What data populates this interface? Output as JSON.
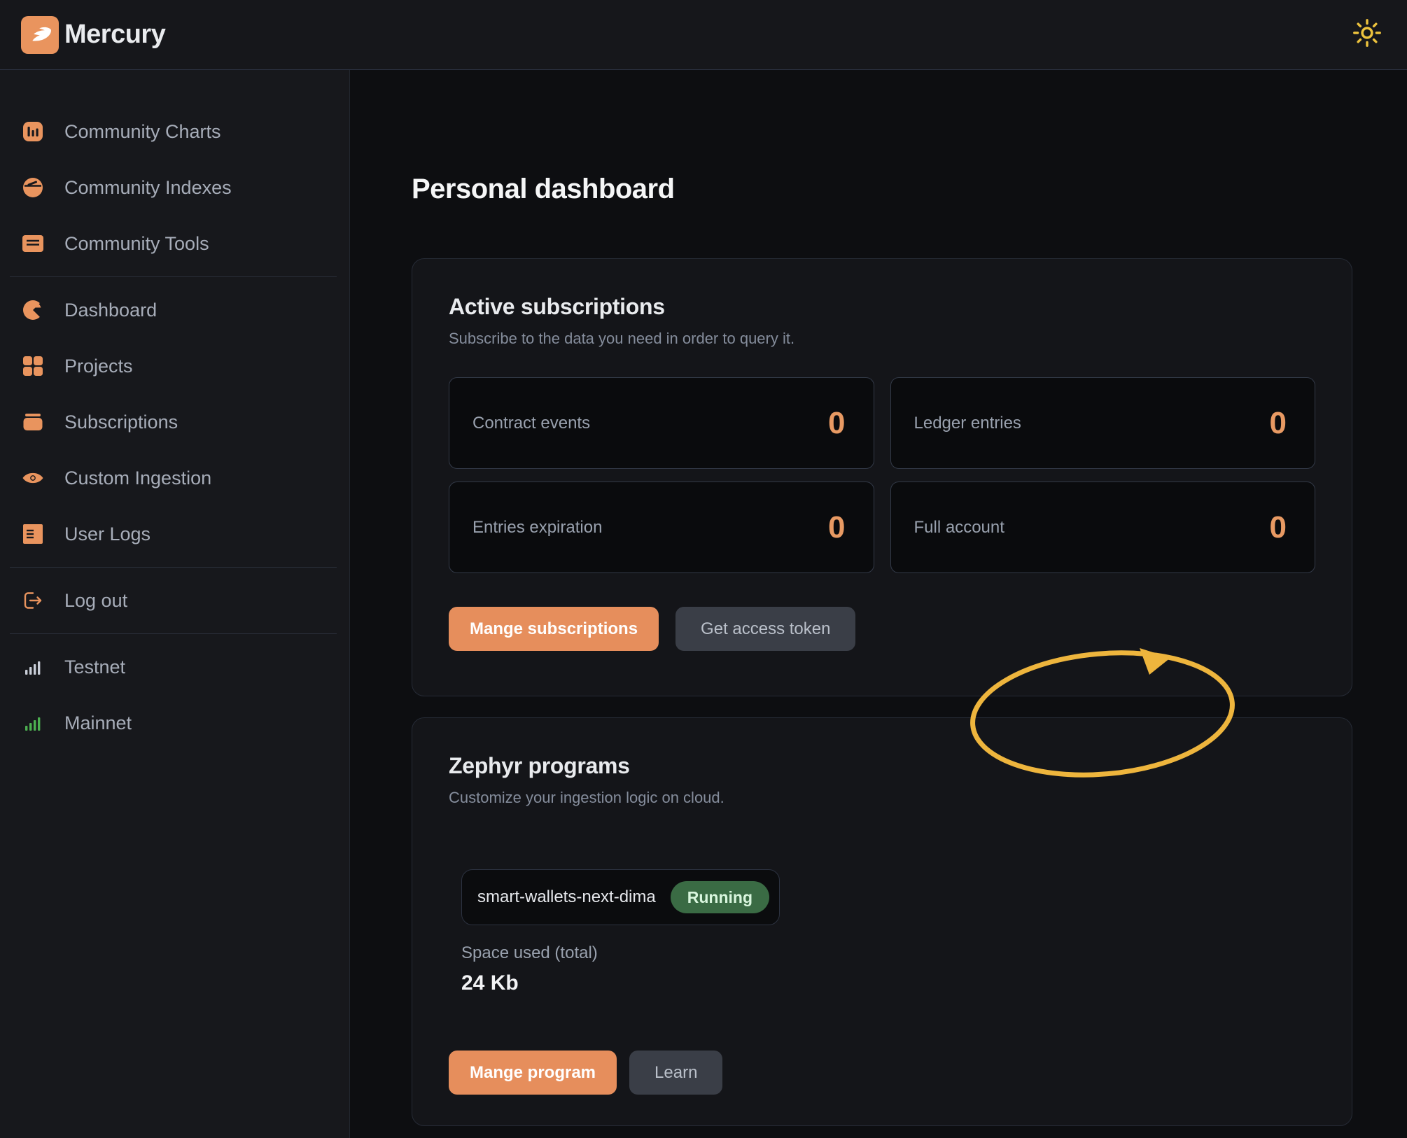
{
  "header": {
    "app_name": "Mercury",
    "logo_icon": "wing-icon",
    "theme_toggle_icon": "sun-icon"
  },
  "sidebar": {
    "items": [
      {
        "label": "Community Charts",
        "icon": "bar-chart-icon"
      },
      {
        "label": "Community Indexes",
        "icon": "gauge-icon"
      },
      {
        "label": "Community Tools",
        "icon": "panel-lines-icon"
      },
      {
        "label": "Dashboard",
        "icon": "pie-chart-icon"
      },
      {
        "label": "Projects",
        "icon": "grid-icon"
      },
      {
        "label": "Subscriptions",
        "icon": "box-icon"
      },
      {
        "label": "Custom Ingestion",
        "icon": "eye-icon"
      },
      {
        "label": "User Logs",
        "icon": "log-icon"
      },
      {
        "label": "Log out",
        "icon": "logout-icon"
      },
      {
        "label": "Testnet",
        "icon": "signal-bars-icon"
      },
      {
        "label": "Mainnet",
        "icon": "signal-bars-icon"
      }
    ]
  },
  "main": {
    "page_title": "Personal dashboard",
    "active_subscriptions": {
      "title": "Active subscriptions",
      "subtitle": "Subscribe to the data you need in order to query it.",
      "stats": [
        {
          "label": "Contract events",
          "value": "0"
        },
        {
          "label": "Ledger entries",
          "value": "0"
        },
        {
          "label": "Entries expiration",
          "value": "0"
        },
        {
          "label": "Full account",
          "value": "0"
        }
      ],
      "manage_button": "Mange subscriptions",
      "token_button": "Get access token"
    },
    "zephyr_programs": {
      "title": "Zephyr programs",
      "subtitle": "Customize your ingestion logic on cloud.",
      "program": {
        "name": "smart-wallets-next-dima",
        "status": "Running"
      },
      "space_used_label": "Space used (total)",
      "space_used_value": "24 Kb",
      "manage_button": "Mange program",
      "learn_button": "Learn"
    }
  },
  "colors": {
    "accent_orange": "#e9945e",
    "annotation_yellow": "#eeb53d",
    "status_running_bg": "#3a6b44",
    "status_running_text": "#d9f6de",
    "mainnet_green": "#4caf50",
    "testnet_gray": "#c9ced8",
    "sun_gold": "#ecc23d"
  }
}
